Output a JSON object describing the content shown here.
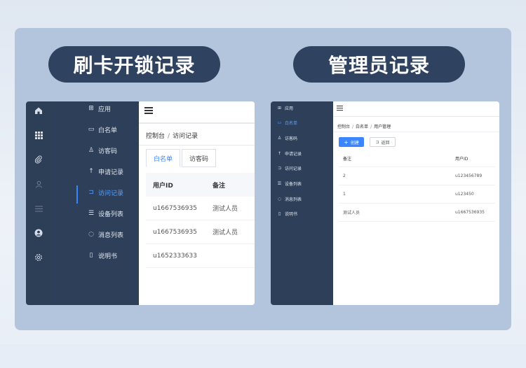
{
  "titles": {
    "left": "刷卡开锁记录",
    "right": "管理员记录"
  },
  "colors": {
    "accent": "#3b86ff",
    "sidebar": "#2e4059",
    "pill": "#2f4361"
  },
  "left_screen": {
    "rail_icons": [
      "home-icon",
      "grid-icon",
      "paperclip-icon",
      "user-icon",
      "list-icon",
      "account-icon",
      "settings-icon"
    ],
    "sidebar_items": [
      {
        "icon": "grid-icon",
        "label": "应用"
      },
      {
        "icon": "card-icon",
        "label": "白名单"
      },
      {
        "icon": "user-icon",
        "label": "访客码"
      },
      {
        "icon": "arrow-up-icon",
        "label": "申请记录"
      },
      {
        "icon": "login-icon",
        "label": "访问记录",
        "active": true
      },
      {
        "icon": "list-icon",
        "label": "设备列表"
      },
      {
        "icon": "chat-icon",
        "label": "消息列表"
      },
      {
        "icon": "book-icon",
        "label": "说明书"
      }
    ],
    "breadcrumb": {
      "root": "控制台",
      "sep": "/",
      "current": "访问记录"
    },
    "tabs": [
      {
        "label": "白名单",
        "active": true
      },
      {
        "label": "访客码"
      }
    ],
    "table": {
      "headers": [
        "用户ID",
        "备注"
      ],
      "rows": [
        [
          "u1667536935",
          "测试人员"
        ],
        [
          "u1667536935",
          "测试人员"
        ],
        [
          "u1652333633",
          ""
        ]
      ]
    }
  },
  "right_screen": {
    "sidebar_items": [
      {
        "icon": "grid-icon",
        "label": "应用"
      },
      {
        "icon": "card-icon",
        "label": "白名单",
        "active": true
      },
      {
        "icon": "user-icon",
        "label": "访客码"
      },
      {
        "icon": "arrow-up-icon",
        "label": "申请记录"
      },
      {
        "icon": "login-icon",
        "label": "访问记录"
      },
      {
        "icon": "list-icon",
        "label": "设备列表"
      },
      {
        "icon": "chat-icon",
        "label": "消息列表"
      },
      {
        "icon": "book-icon",
        "label": "说明书"
      }
    ],
    "breadcrumb": {
      "root": "控制台",
      "sep": "/",
      "mid": "白名单",
      "current": "用户管理"
    },
    "buttons": {
      "create": "创建",
      "back": "返回"
    },
    "table": {
      "headers": [
        "备注",
        "用户ID"
      ],
      "rows": [
        [
          "2",
          "u123456789"
        ],
        [
          "1",
          "u123450"
        ],
        [
          "测试人员",
          "u1667536935"
        ]
      ]
    }
  }
}
